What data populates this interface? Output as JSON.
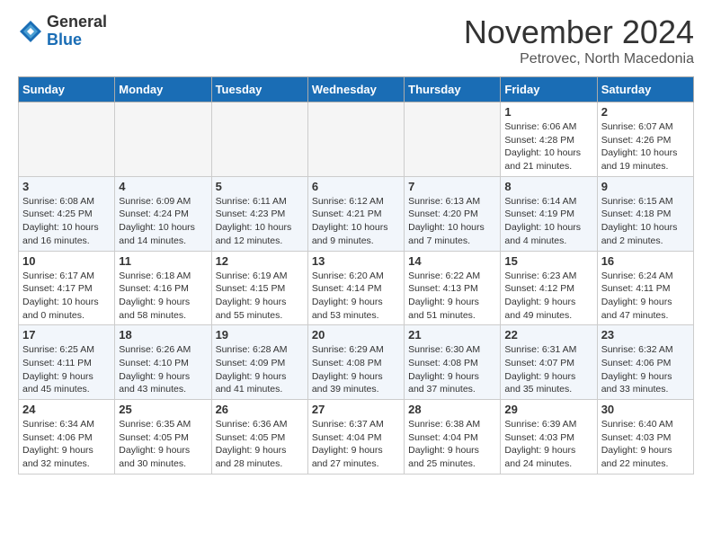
{
  "header": {
    "logo_line1": "General",
    "logo_line2": "Blue",
    "month": "November 2024",
    "location": "Petrovec, North Macedonia"
  },
  "weekdays": [
    "Sunday",
    "Monday",
    "Tuesday",
    "Wednesday",
    "Thursday",
    "Friday",
    "Saturday"
  ],
  "weeks": [
    [
      {
        "day": "",
        "content": ""
      },
      {
        "day": "",
        "content": ""
      },
      {
        "day": "",
        "content": ""
      },
      {
        "day": "",
        "content": ""
      },
      {
        "day": "",
        "content": ""
      },
      {
        "day": "1",
        "content": "Sunrise: 6:06 AM\nSunset: 4:28 PM\nDaylight: 10 hours\nand 21 minutes."
      },
      {
        "day": "2",
        "content": "Sunrise: 6:07 AM\nSunset: 4:26 PM\nDaylight: 10 hours\nand 19 minutes."
      }
    ],
    [
      {
        "day": "3",
        "content": "Sunrise: 6:08 AM\nSunset: 4:25 PM\nDaylight: 10 hours\nand 16 minutes."
      },
      {
        "day": "4",
        "content": "Sunrise: 6:09 AM\nSunset: 4:24 PM\nDaylight: 10 hours\nand 14 minutes."
      },
      {
        "day": "5",
        "content": "Sunrise: 6:11 AM\nSunset: 4:23 PM\nDaylight: 10 hours\nand 12 minutes."
      },
      {
        "day": "6",
        "content": "Sunrise: 6:12 AM\nSunset: 4:21 PM\nDaylight: 10 hours\nand 9 minutes."
      },
      {
        "day": "7",
        "content": "Sunrise: 6:13 AM\nSunset: 4:20 PM\nDaylight: 10 hours\nand 7 minutes."
      },
      {
        "day": "8",
        "content": "Sunrise: 6:14 AM\nSunset: 4:19 PM\nDaylight: 10 hours\nand 4 minutes."
      },
      {
        "day": "9",
        "content": "Sunrise: 6:15 AM\nSunset: 4:18 PM\nDaylight: 10 hours\nand 2 minutes."
      }
    ],
    [
      {
        "day": "10",
        "content": "Sunrise: 6:17 AM\nSunset: 4:17 PM\nDaylight: 10 hours\nand 0 minutes."
      },
      {
        "day": "11",
        "content": "Sunrise: 6:18 AM\nSunset: 4:16 PM\nDaylight: 9 hours\nand 58 minutes."
      },
      {
        "day": "12",
        "content": "Sunrise: 6:19 AM\nSunset: 4:15 PM\nDaylight: 9 hours\nand 55 minutes."
      },
      {
        "day": "13",
        "content": "Sunrise: 6:20 AM\nSunset: 4:14 PM\nDaylight: 9 hours\nand 53 minutes."
      },
      {
        "day": "14",
        "content": "Sunrise: 6:22 AM\nSunset: 4:13 PM\nDaylight: 9 hours\nand 51 minutes."
      },
      {
        "day": "15",
        "content": "Sunrise: 6:23 AM\nSunset: 4:12 PM\nDaylight: 9 hours\nand 49 minutes."
      },
      {
        "day": "16",
        "content": "Sunrise: 6:24 AM\nSunset: 4:11 PM\nDaylight: 9 hours\nand 47 minutes."
      }
    ],
    [
      {
        "day": "17",
        "content": "Sunrise: 6:25 AM\nSunset: 4:11 PM\nDaylight: 9 hours\nand 45 minutes."
      },
      {
        "day": "18",
        "content": "Sunrise: 6:26 AM\nSunset: 4:10 PM\nDaylight: 9 hours\nand 43 minutes."
      },
      {
        "day": "19",
        "content": "Sunrise: 6:28 AM\nSunset: 4:09 PM\nDaylight: 9 hours\nand 41 minutes."
      },
      {
        "day": "20",
        "content": "Sunrise: 6:29 AM\nSunset: 4:08 PM\nDaylight: 9 hours\nand 39 minutes."
      },
      {
        "day": "21",
        "content": "Sunrise: 6:30 AM\nSunset: 4:08 PM\nDaylight: 9 hours\nand 37 minutes."
      },
      {
        "day": "22",
        "content": "Sunrise: 6:31 AM\nSunset: 4:07 PM\nDaylight: 9 hours\nand 35 minutes."
      },
      {
        "day": "23",
        "content": "Sunrise: 6:32 AM\nSunset: 4:06 PM\nDaylight: 9 hours\nand 33 minutes."
      }
    ],
    [
      {
        "day": "24",
        "content": "Sunrise: 6:34 AM\nSunset: 4:06 PM\nDaylight: 9 hours\nand 32 minutes."
      },
      {
        "day": "25",
        "content": "Sunrise: 6:35 AM\nSunset: 4:05 PM\nDaylight: 9 hours\nand 30 minutes."
      },
      {
        "day": "26",
        "content": "Sunrise: 6:36 AM\nSunset: 4:05 PM\nDaylight: 9 hours\nand 28 minutes."
      },
      {
        "day": "27",
        "content": "Sunrise: 6:37 AM\nSunset: 4:04 PM\nDaylight: 9 hours\nand 27 minutes."
      },
      {
        "day": "28",
        "content": "Sunrise: 6:38 AM\nSunset: 4:04 PM\nDaylight: 9 hours\nand 25 minutes."
      },
      {
        "day": "29",
        "content": "Sunrise: 6:39 AM\nSunset: 4:03 PM\nDaylight: 9 hours\nand 24 minutes."
      },
      {
        "day": "30",
        "content": "Sunrise: 6:40 AM\nSunset: 4:03 PM\nDaylight: 9 hours\nand 22 minutes."
      }
    ]
  ]
}
